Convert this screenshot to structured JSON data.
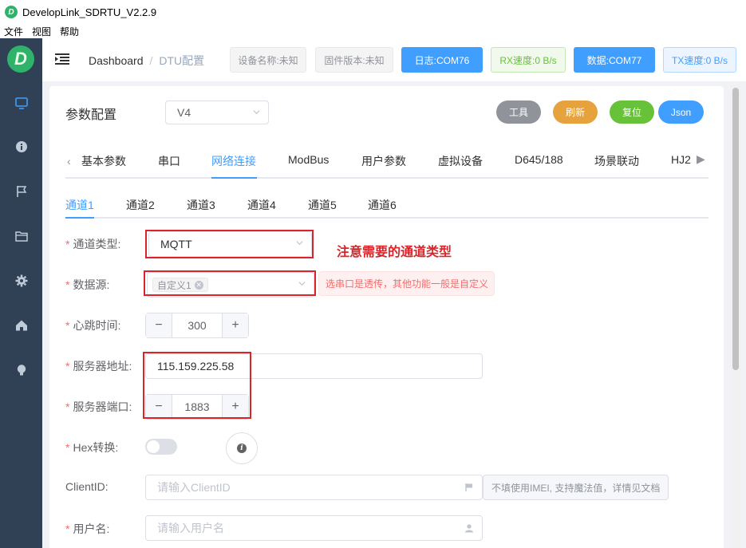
{
  "window": {
    "title": "DevelopLink_SDRTU_V2.2.9",
    "logo_letter": "D"
  },
  "menu": [
    "文件",
    "视图",
    "帮助"
  ],
  "sidebar": {
    "logo_letter": "D",
    "icons": [
      "monitor-icon",
      "info-icon",
      "flag-icon",
      "folder-icon",
      "gear-icon",
      "home-icon",
      "bulb-icon"
    ]
  },
  "header": {
    "breadcrumb": [
      "Dashboard",
      "DTU配置"
    ],
    "device_name": "设备名称:未知",
    "firmware": "固件版本:未知",
    "log_port": "日志:COM76",
    "rx_speed": "RX速度:0 B/s",
    "data_port": "数据:COM77",
    "tx_speed": "TX速度:0 B/s"
  },
  "card": {
    "title": "参数配置",
    "version": "V4",
    "actions": {
      "tool": "工具",
      "refresh": "刷新",
      "reset": "复位",
      "json": "Json"
    },
    "colors": {
      "tool": "#909399",
      "refresh": "#e6a23c",
      "reset": "#67c23a",
      "json": "#409eff"
    }
  },
  "tabs": [
    "基本参数",
    "串口",
    "网络连接",
    "ModBus",
    "用户参数",
    "虚拟设备",
    "D645/188",
    "场景联动",
    "HJ2"
  ],
  "active_tab": "网络连接",
  "subtabs": [
    "通道1",
    "通道2",
    "通道3",
    "通道4",
    "通道5",
    "通道6"
  ],
  "form": {
    "channel_type": {
      "label": "通道类型:",
      "value": "MQTT",
      "note": "注意需要的通道类型"
    },
    "data_source": {
      "label": "数据源:",
      "tag": "自定义1",
      "alert": "选串口是透传，其他功能一般是自定义"
    },
    "heartbeat": {
      "label": "心跳时间:",
      "value": "300"
    },
    "server_addr": {
      "label": "服务器地址:",
      "value": "115.159.225.58"
    },
    "server_port": {
      "label": "服务器端口:",
      "value": "1883"
    },
    "hex": {
      "label": "Hex转换:"
    },
    "client_id": {
      "label": "ClientID:",
      "placeholder": "请输入ClientID",
      "hint": "不填使用IMEI, 支持魔法值，详情见文档"
    },
    "username": {
      "label": "用户名:",
      "placeholder": "请输入用户名"
    }
  }
}
